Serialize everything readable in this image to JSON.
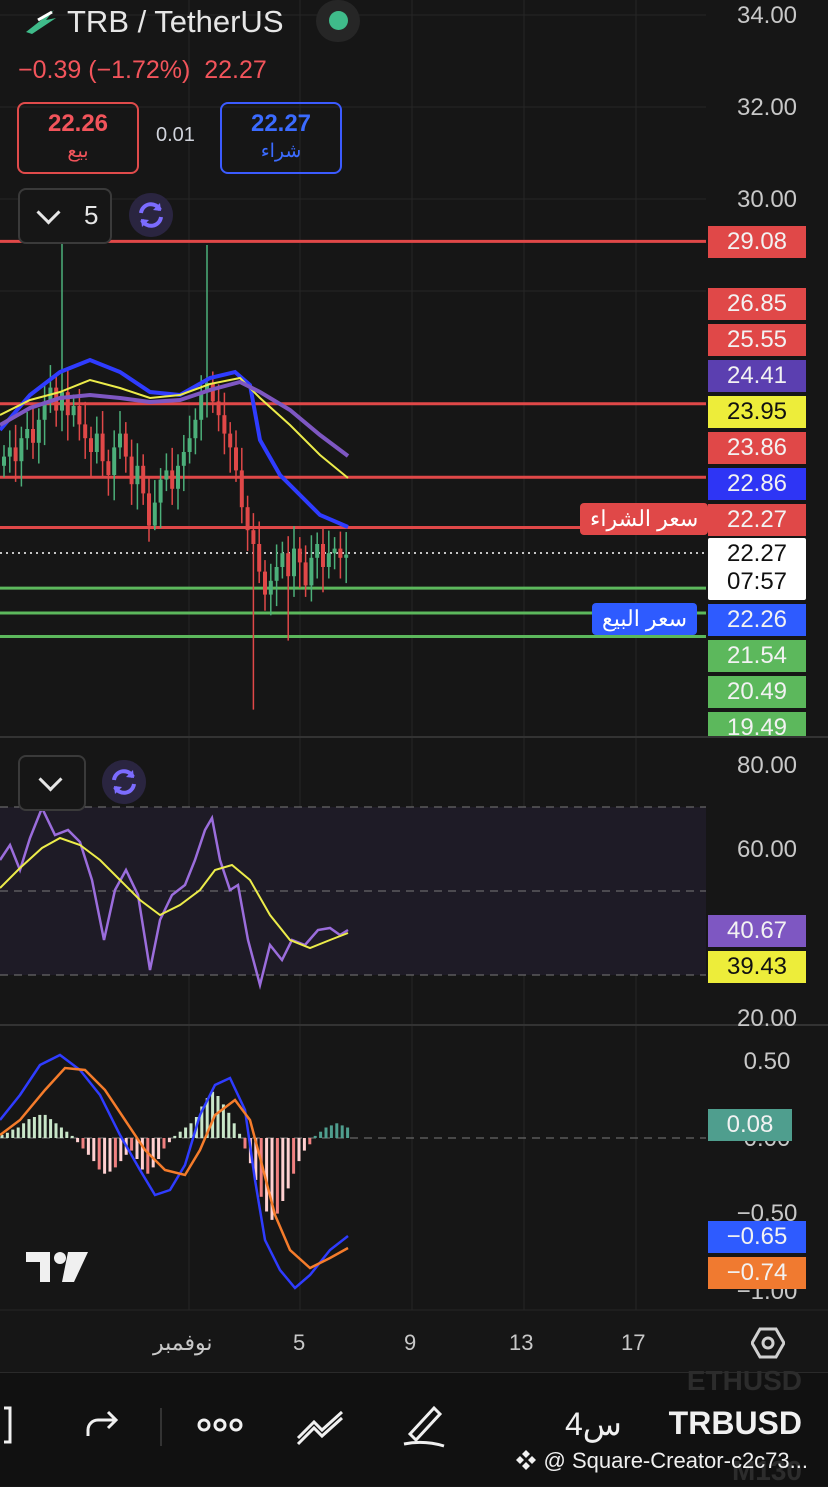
{
  "header": {
    "symbol": "TRB / TetherUS",
    "change": "−0.39 (−1.72%)",
    "last": "22.27",
    "bid": {
      "price": "22.26",
      "label": "بيع"
    },
    "ask": {
      "price": "22.27",
      "label": "شراء"
    },
    "spread": "0.01",
    "interval_count": "5"
  },
  "colors": {
    "bg": "#161616",
    "red": "#f2545b",
    "green": "#5cb85c",
    "blue": "#2f3cff",
    "purple": "#7e57c2",
    "yellow": "#ecec4a",
    "teal": "#4f9e8e",
    "orange": "#f57c2b"
  },
  "icons": [
    "app-logo-icon",
    "status-dot-icon",
    "chevron-down-icon",
    "refresh-icon",
    "settings-hexagon-icon",
    "fullscreen-icon",
    "redo-icon",
    "more-icon",
    "drawing-tools-icon",
    "brush-icon",
    "tradingview-logo-icon",
    "binance-logo-icon"
  ],
  "price_axis": [
    "34.00",
    "32.00",
    "30.00"
  ],
  "price_tags": {
    "l1": "29.08",
    "l2": "26.85",
    "l3": "25.55",
    "l4": "24.41",
    "l5": "23.95",
    "l6": "23.86",
    "l7": "22.86",
    "l8": "22.27",
    "current": "22.27",
    "countdown": "07:57",
    "l9": "22.26",
    "l10": "21.54",
    "l11": "20.49",
    "l12": "19.49"
  },
  "labels": {
    "buy_price": "سعر الشراء",
    "sell_price": "سعر البيع"
  },
  "rsi": {
    "axis_top": "80.00",
    "axis_mid": "60.00",
    "axis_low": "20.00",
    "rsi": "40.67",
    "ma": "39.43"
  },
  "macd": {
    "axis_top": "0.50",
    "axis_mid": "0.00",
    "axis_low": "−0.50",
    "axis_bottom": "−1.00",
    "hist": "0.08",
    "macd": "−0.65",
    "signal": "−0.74"
  },
  "x_axis": [
    "نوفمبر",
    "5",
    "9",
    "13",
    "17"
  ],
  "bottom": {
    "ticker": "TRBUSD",
    "timeframe": "4س",
    "watermark_top": "ETHUSD",
    "watermark_bottom": "M130",
    "creator": "@ Square-Creator-c2c73..."
  },
  "chart_data": {
    "type": "candlestick",
    "description_series": [
      "price",
      "EMA fast",
      "EMA mid",
      "EMA slow"
    ],
    "horizontal_levels": [
      29.08,
      25.55,
      23.95,
      22.86,
      21.54,
      21.0,
      20.49
    ],
    "last_price": 22.27,
    "rsi_last": 40.67,
    "rsi_ma_last": 39.43,
    "macd_last": -0.65,
    "signal_last": -0.74,
    "hist_last": 0.08
  }
}
